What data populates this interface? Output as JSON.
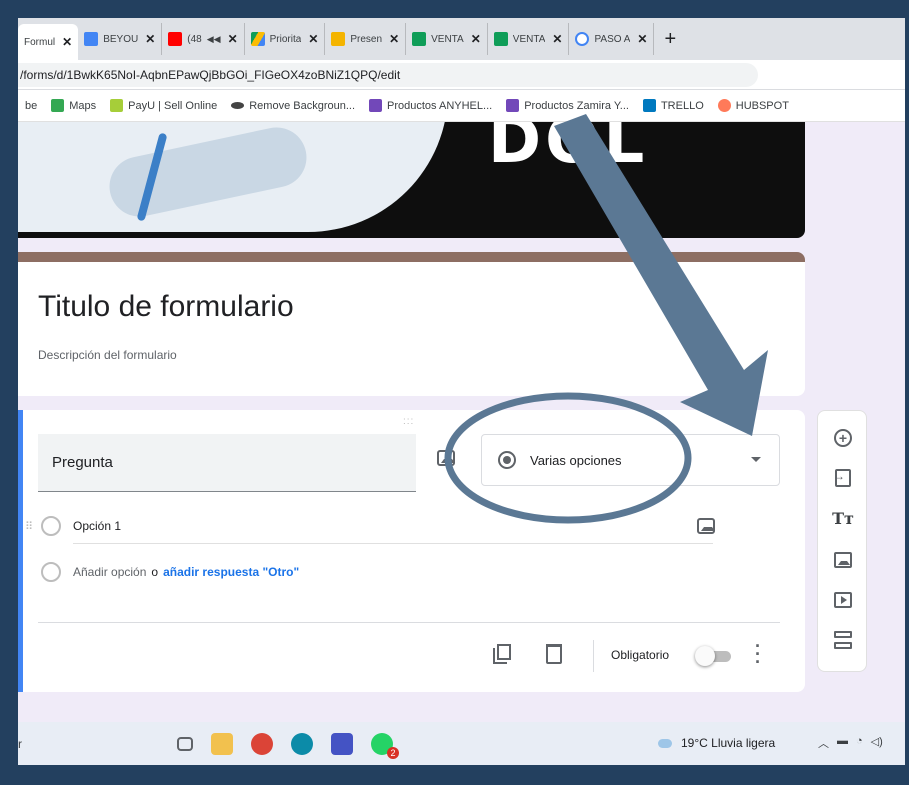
{
  "browser": {
    "tabs": [
      {
        "label": "Formul",
        "active": true,
        "favicon_color": "#7248b9"
      },
      {
        "label": "BEYOU",
        "active": false,
        "favicon_color": "#4285f4"
      },
      {
        "label": "(48",
        "active": false,
        "favicon_color": "#ff0000"
      },
      {
        "label": "Priorita",
        "active": false,
        "favicon_color": "#fbbc04"
      },
      {
        "label": "Presen",
        "active": false,
        "favicon_color": "#f4b400"
      },
      {
        "label": "VENTA",
        "active": false,
        "favicon_color": "#0f9d58"
      },
      {
        "label": "VENTA",
        "active": false,
        "favicon_color": "#0f9d58"
      },
      {
        "label": "PASO A",
        "active": false,
        "favicon_color": "#4285f4"
      }
    ],
    "new_tab_symbol": "+",
    "url": "/forms/d/1BwkK65NoI-AqbnEPawQjBbGOi_FIGeOX4zoBNiZ1QPQ/edit",
    "bookmarks": [
      {
        "label": "be",
        "icon_color": "transparent"
      },
      {
        "label": "Maps",
        "icon_color": "#34a853"
      },
      {
        "label": "PayU | Sell Online",
        "icon_color": "#a6ce39"
      },
      {
        "label": "Remove Backgroun...",
        "icon_color": "#444444"
      },
      {
        "label": "Productos ANYHEL...",
        "icon_color": "#7248b9"
      },
      {
        "label": "Productos Zamira Y...",
        "icon_color": "#7248b9"
      },
      {
        "label": "TRELLO",
        "icon_color": "#0079bf"
      },
      {
        "label": "HUBSPOT",
        "icon_color": "#ff7a59"
      }
    ]
  },
  "header_image": {
    "logo_text": "DOL"
  },
  "form": {
    "title": "Titulo de formulario",
    "description": "Descripción del formulario",
    "accent_color": "#8d6e63",
    "question": {
      "drag_handle": ":::",
      "placeholder": "Pregunta",
      "type_label": "Varias opciones",
      "options": [
        {
          "label": "Opción 1"
        }
      ],
      "add_option_label": "Añadir opción",
      "or_label": "o",
      "add_other_label": "añadir respuesta \"Otro\"",
      "required_label": "Obligatorio",
      "required": false
    }
  },
  "toolbar": {
    "items": [
      "add-question-icon",
      "import-questions-icon",
      "add-title-icon",
      "add-image-icon",
      "add-video-icon",
      "add-section-icon"
    ],
    "title_glyph": "Tт"
  },
  "annotation": {
    "arrow_color": "#5b7894",
    "ellipse_color": "#5b7894"
  },
  "taskbar": {
    "search_text": "r",
    "weather": "19°C  Lluvia ligera",
    "notification_badge": "2"
  }
}
